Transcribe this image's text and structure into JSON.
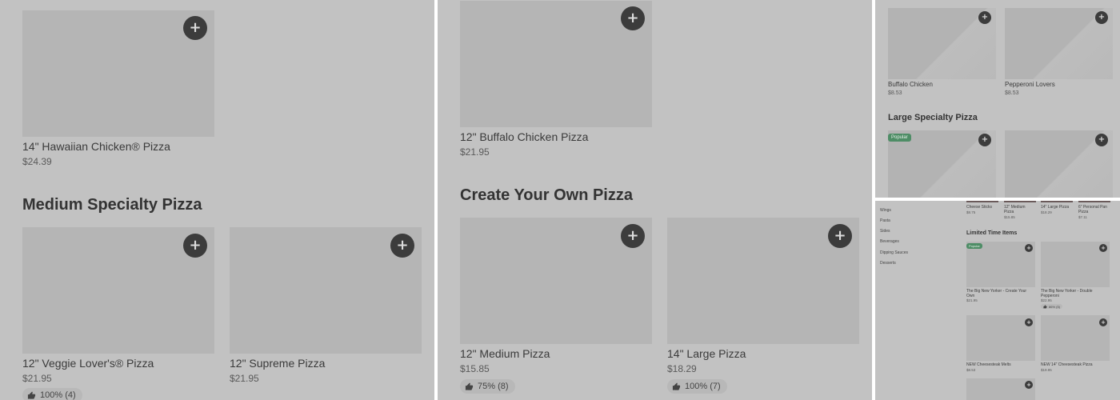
{
  "panel1": {
    "items": [
      {
        "name": "14\" Hawaiian Chicken® Pizza",
        "price": "$24.39"
      },
      {
        "name": "12\" Veggie Lover's® Pizza",
        "price": "$21.95",
        "rating": "100% (4)"
      },
      {
        "name": "12\" Supreme Pizza",
        "price": "$21.95"
      }
    ],
    "section": "Medium Specialty Pizza"
  },
  "panel2": {
    "items": [
      {
        "name": "12\" Buffalo Chicken Pizza",
        "price": "$21.95"
      },
      {
        "name": "12\" Medium Pizza",
        "price": "$15.85",
        "rating": "75% (8)"
      },
      {
        "name": "14\" Large Pizza",
        "price": "$18.29",
        "rating": "100% (7)"
      }
    ],
    "section": "Create Your Own Pizza"
  },
  "panel3": {
    "items": [
      {
        "name": "Buffalo Chicken",
        "price": "$8.53"
      },
      {
        "name": "Pepperoni Lovers",
        "price": "$8.53"
      }
    ],
    "section": "Large Specialty Pizza",
    "popular_badge": "Popular"
  },
  "panel4": {
    "sidebar": [
      "Wings",
      "Pasta",
      "Sides",
      "Beverages",
      "Dipping Sauces",
      "Desserts"
    ],
    "top_items": [
      {
        "name": "Cheese Sticks",
        "price": "$8.75"
      },
      {
        "name": "12\" Medium Pizza",
        "price": "$15.85"
      },
      {
        "name": "14\" Large Pizza",
        "price": "$18.29"
      },
      {
        "name": "6\" Personal Pan Pizza",
        "price": "$7.11"
      }
    ],
    "section": "Limited Time Items",
    "popular_badge": "Popular",
    "items": [
      {
        "name": "The Big New Yorker - Create Your Own",
        "price": "$21.95"
      },
      {
        "name": "The Big New Yorker - Double Pepperoni",
        "price": "$22.95",
        "rating": "86% (5)"
      },
      {
        "name": "NEW Cheesesteak Melts",
        "price": "$8.53"
      },
      {
        "name": "NEW 14\" Cheesesteak Pizza",
        "price": "$19.95"
      }
    ]
  },
  "icons": {
    "add": "+",
    "thumbs_up": "thumbs-up-icon"
  },
  "colors": {
    "background": "#c2c2c2",
    "button": "#3c3c3c",
    "popular": "#4e8d66"
  }
}
